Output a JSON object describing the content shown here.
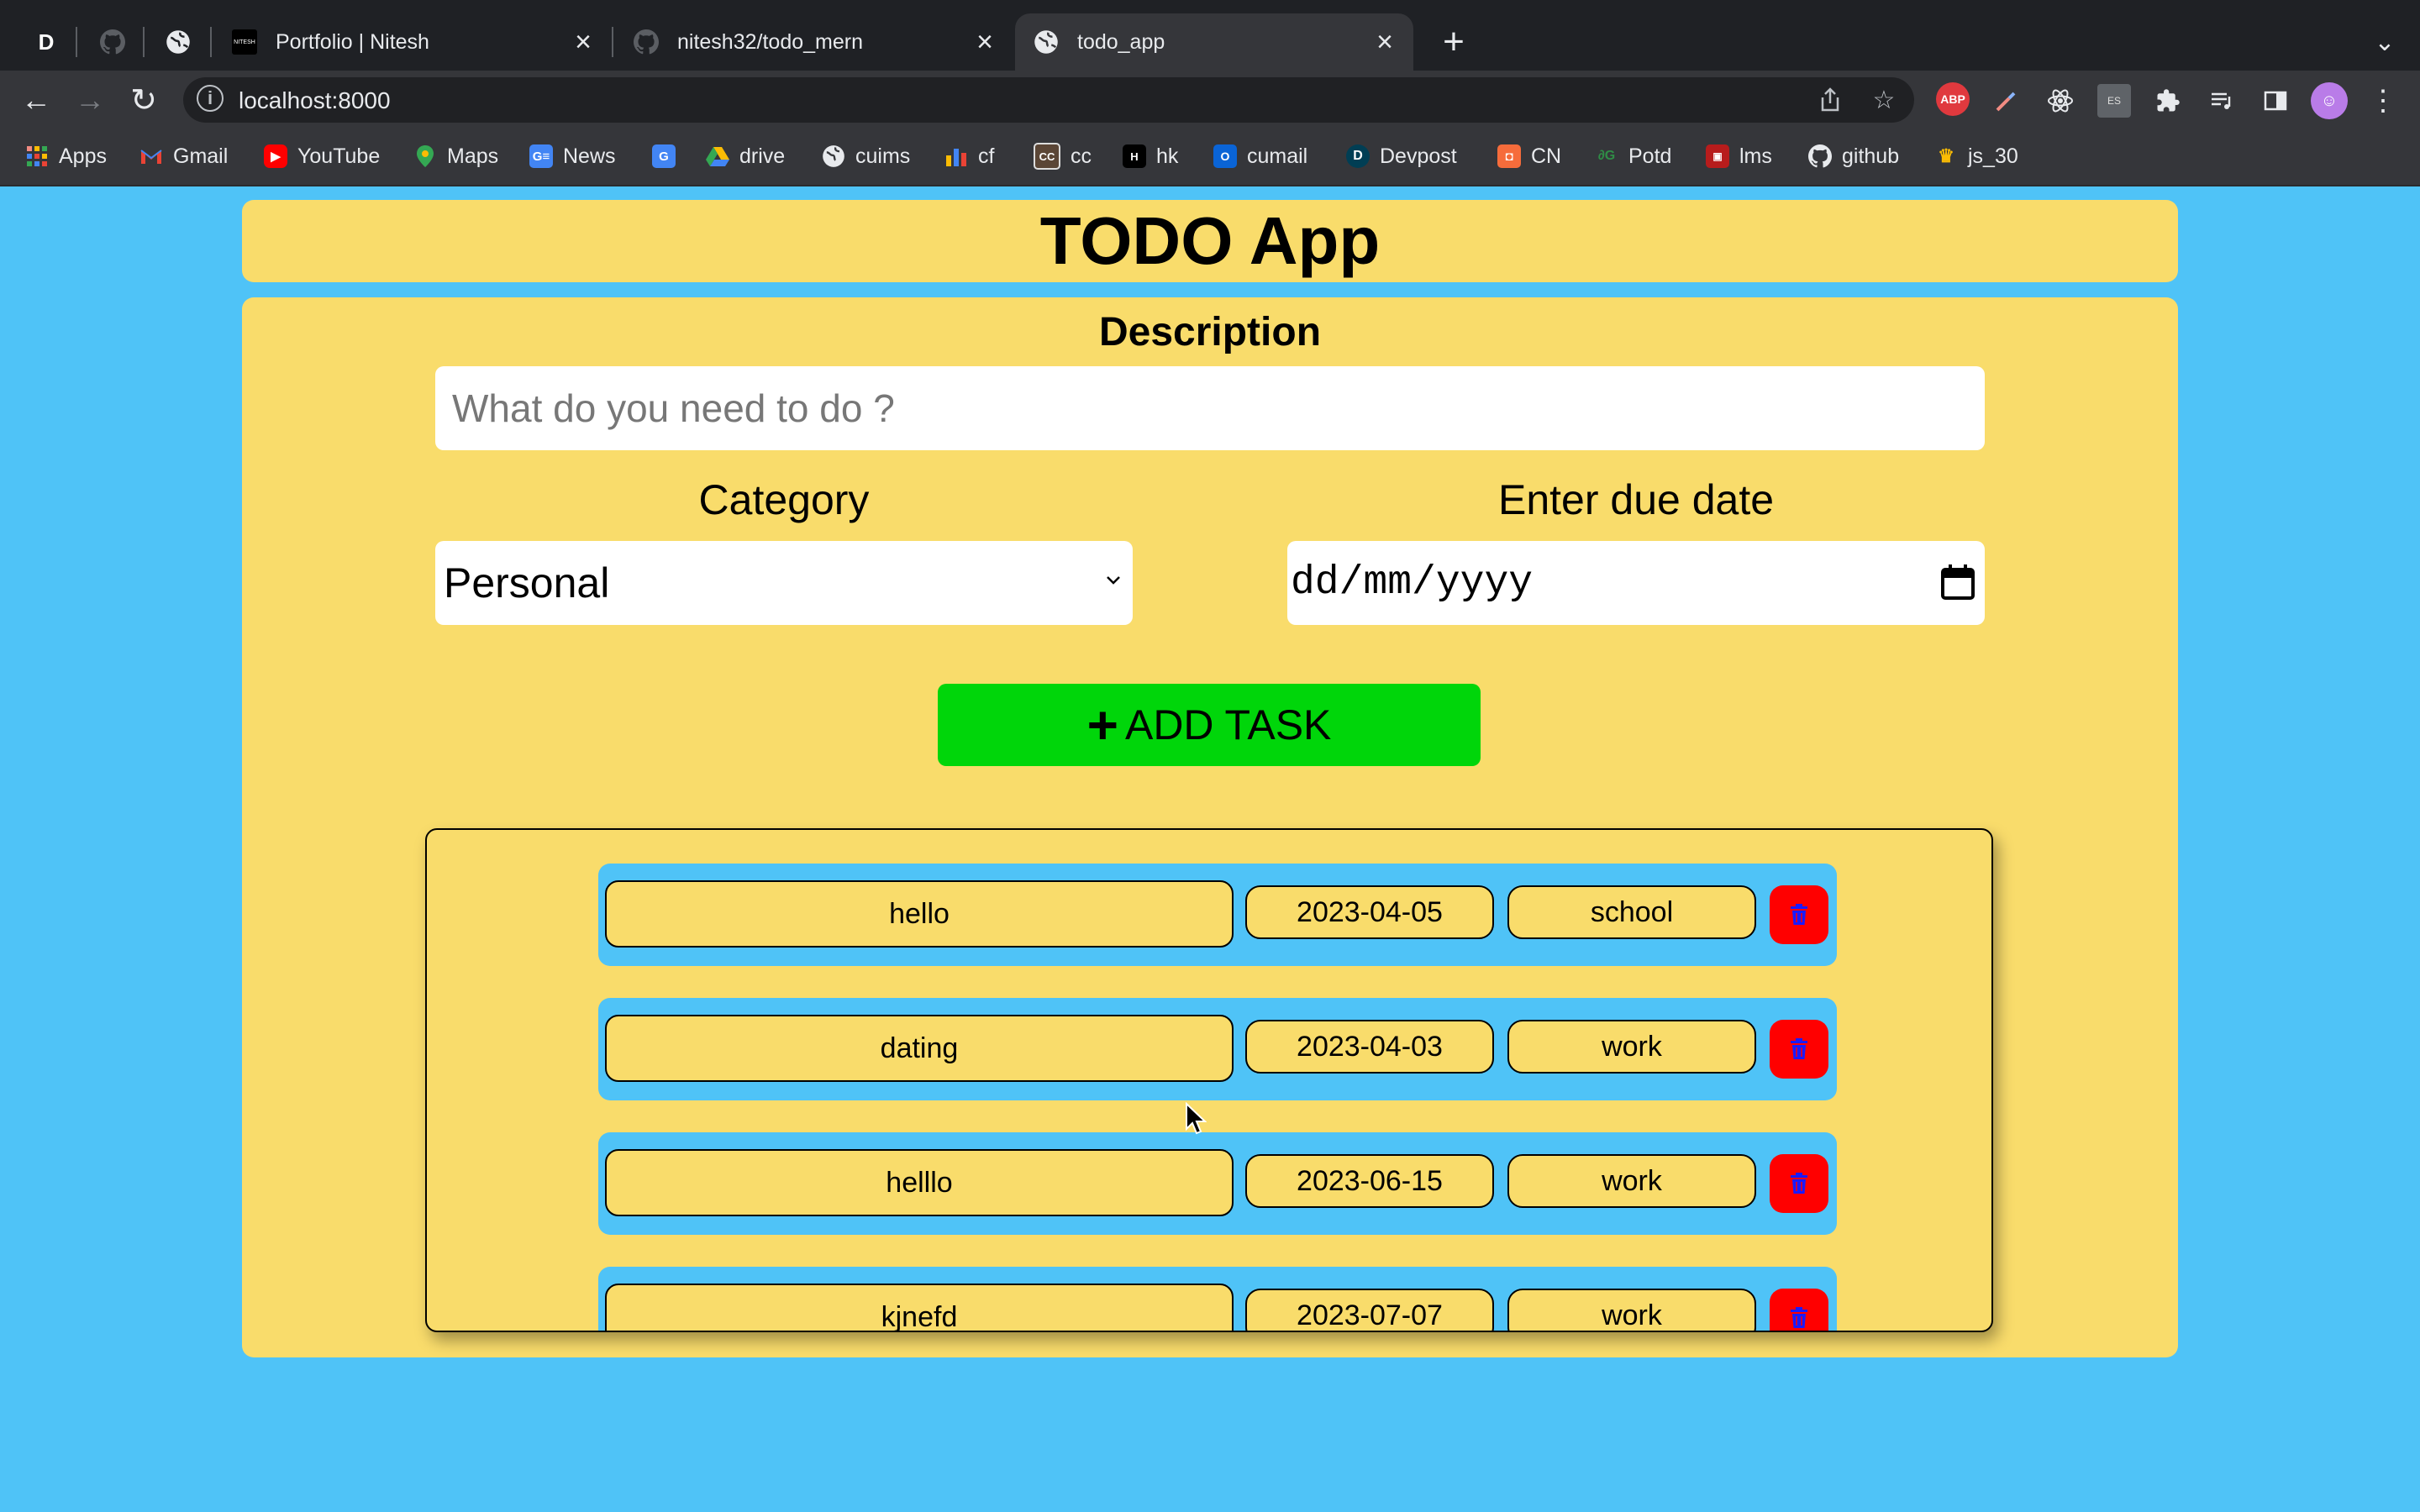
{
  "browser": {
    "pinned_tab_label": "D",
    "tabs": [
      {
        "title": "Portfolio | Nitesh",
        "favicon_text": "NITESH"
      },
      {
        "title": "nitesh32/todo_mern"
      },
      {
        "title": "todo_app",
        "active": true
      }
    ],
    "url": "localhost:8000",
    "bookmarks": [
      {
        "label": "Apps",
        "icon": "apps-grid-icon"
      },
      {
        "label": "Gmail",
        "icon": "gmail-icon"
      },
      {
        "label": "YouTube",
        "icon": "youtube-icon"
      },
      {
        "label": "Maps",
        "icon": "maps-icon"
      },
      {
        "label": "News",
        "icon": "news-icon"
      },
      {
        "label": "",
        "icon": "translate-icon"
      },
      {
        "label": "drive",
        "icon": "drive-icon"
      },
      {
        "label": "cuims",
        "icon": "globe-icon"
      },
      {
        "label": "cf",
        "icon": "codeforces-icon"
      },
      {
        "label": "cc",
        "icon": "codechef-icon"
      },
      {
        "label": "hk",
        "icon": "hackerrank-icon"
      },
      {
        "label": "cumail",
        "icon": "outlook-icon"
      },
      {
        "label": "Devpost",
        "icon": "devpost-icon"
      },
      {
        "label": "CN",
        "icon": "codingninjas-icon"
      },
      {
        "label": "Potd",
        "icon": "gfg-icon"
      },
      {
        "label": "lms",
        "icon": "lms-icon"
      },
      {
        "label": "github",
        "icon": "github-icon"
      },
      {
        "label": "js_30",
        "icon": "crown-icon"
      }
    ],
    "extensions": {
      "abp_label": "ABP",
      "es_label": "ES"
    }
  },
  "app": {
    "title": "TODO App",
    "description_label": "Description",
    "description_placeholder": "What do you need to do ?",
    "category_label": "Category",
    "category_value": "Personal",
    "due_date_label": "Enter due date",
    "due_date_placeholder": "dd/mm/yyyy",
    "add_button_label": "ADD TASK",
    "add_button_symbol": "+"
  },
  "tasks": [
    {
      "title": "hello",
      "date": "2023-04-05",
      "category": "school"
    },
    {
      "title": "dating",
      "date": "2023-04-03",
      "category": "work"
    },
    {
      "title": "helllo",
      "date": "2023-06-15",
      "category": "work"
    },
    {
      "title": "kjnefd",
      "date": "2023-07-07",
      "category": "work"
    }
  ],
  "colors": {
    "page_bg": "#4fc3f7",
    "card_bg": "#f9dc6b",
    "add_button": "#00d60a",
    "delete_button": "#ff0000",
    "trash_icon": "#1a1aff"
  }
}
